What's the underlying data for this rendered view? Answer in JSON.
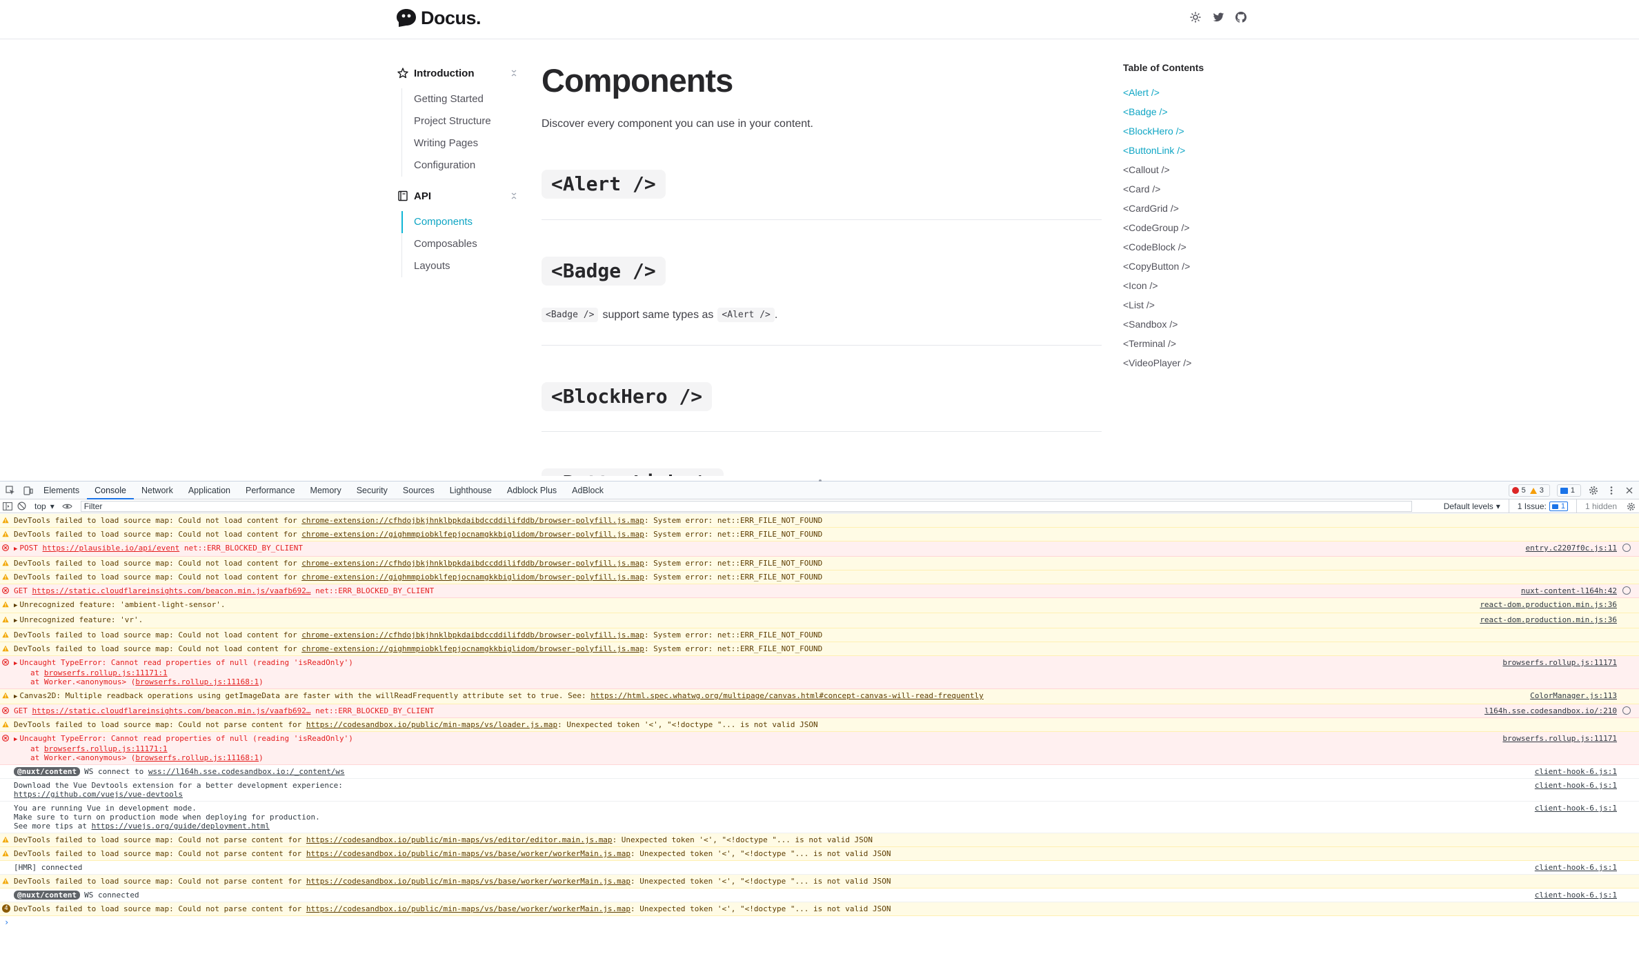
{
  "site": {
    "logo_text": "Docus.",
    "header_icons": [
      "sun-icon",
      "twitter-icon",
      "github-icon"
    ]
  },
  "nav": {
    "groups": [
      {
        "label": "Introduction",
        "icon": "star-icon",
        "items": [
          "Getting Started",
          "Project Structure",
          "Writing Pages",
          "Configuration"
        ]
      },
      {
        "label": "API",
        "icon": "book-icon",
        "items": [
          "Components",
          "Composables",
          "Layouts"
        ]
      }
    ],
    "active_item": "Components"
  },
  "main": {
    "title": "Components",
    "intro": "Discover every component you can use in your content.",
    "sections": [
      "<Alert />",
      "<Badge />",
      "<BlockHero />",
      "<ButtonLink />"
    ],
    "badge_text": {
      "code1": "<Badge />",
      "middle": "support same types as",
      "code2": "<Alert />",
      "end": "."
    }
  },
  "toc": {
    "title": "Table of Contents",
    "items": [
      "<Alert />",
      "<Badge />",
      "<BlockHero />",
      "<ButtonLink />",
      "<Callout />",
      "<Card />",
      "<CardGrid />",
      "<CodeGroup />",
      "<CodeBlock />",
      "<CopyButton />",
      "<Icon />",
      "<List />",
      "<Sandbox />",
      "<Terminal />",
      "<VideoPlayer />"
    ],
    "active_count": 4
  },
  "devtools": {
    "tabs": [
      "Elements",
      "Console",
      "Network",
      "Application",
      "Performance",
      "Memory",
      "Security",
      "Sources",
      "Lighthouse",
      "Adblock Plus",
      "AdBlock"
    ],
    "active_tab": "Console",
    "counts": {
      "errors": "5",
      "warnings": "3",
      "messages": "1"
    },
    "context": "top",
    "filter_placeholder": "Filter",
    "levels": "Default levels",
    "issues_label": "1 Issue:",
    "issues_count": "1",
    "hidden": "1 hidden",
    "colors": {
      "accent": "#10b6d6",
      "error": "#e41e1e",
      "warn_bg": "#fffbe5",
      "tab_underline": "#1a73e8"
    }
  },
  "console": [
    {
      "level": "warn",
      "text": "DevTools failed to load source map: Could not load content for ",
      "link": "chrome-extension://cfhdojbkjhnklbpkdaibdccddilifddb/browser-polyfill.js.map",
      "tail": ": System error: net::ERR_FILE_NOT_FOUND"
    },
    {
      "level": "warn",
      "text": "DevTools failed to load source map: Could not load content for ",
      "link": "chrome-extension://gighmmpiobklfepjocnamgkkbiglidom/browser-polyfill.js.map",
      "tail": ": System error: net::ERR_FILE_NOT_FOUND"
    },
    {
      "level": "error",
      "expand": true,
      "text": "POST ",
      "link": "https://plausible.io/api/event",
      "tail": " net::ERR_BLOCKED_BY_CLIENT",
      "source": "entry.c2207f0c.js:11",
      "src_icon": true
    },
    {
      "level": "warn",
      "text": "DevTools failed to load source map: Could not load content for ",
      "link": "chrome-extension://cfhdojbkjhnklbpkdaibdccddilifddb/browser-polyfill.js.map",
      "tail": ": System error: net::ERR_FILE_NOT_FOUND"
    },
    {
      "level": "warn",
      "text": "DevTools failed to load source map: Could not load content for ",
      "link": "chrome-extension://gighmmpiobklfepjocnamgkkbiglidom/browser-polyfill.js.map",
      "tail": ": System error: net::ERR_FILE_NOT_FOUND"
    },
    {
      "level": "error",
      "text": "GET ",
      "link": "https://static.cloudflareinsights.com/beacon.min.js/vaafb692…",
      "tail": " net::ERR_BLOCKED_BY_CLIENT",
      "source": "nuxt-content-l164h:42",
      "src_icon": true
    },
    {
      "level": "warn",
      "expand": true,
      "text": "Unrecognized feature: 'ambient-light-sensor'.",
      "source": "react-dom.production.min.js:36"
    },
    {
      "level": "warn",
      "expand": true,
      "text": "Unrecognized feature: 'vr'.",
      "source": "react-dom.production.min.js:36"
    },
    {
      "level": "warn",
      "text": "DevTools failed to load source map: Could not load content for ",
      "link": "chrome-extension://cfhdojbkjhnklbpkdaibdccddilifddb/browser-polyfill.js.map",
      "tail": ": System error: net::ERR_FILE_NOT_FOUND"
    },
    {
      "level": "warn",
      "text": "DevTools failed to load source map: Could not load content for ",
      "link": "chrome-extension://gighmmpiobklfepjocnamgkkbiglidom/browser-polyfill.js.map",
      "tail": ": System error: net::ERR_FILE_NOT_FOUND"
    },
    {
      "level": "error",
      "expand": true,
      "text": "Uncaught TypeError: Cannot read properties of null (reading 'isReadOnly')",
      "stack": [
        [
          "at ",
          "browserfs.rollup.js:11171:1",
          ""
        ],
        [
          "at Worker.<anonymous> (",
          "browserfs.rollup.js:11168:1",
          ")"
        ]
      ],
      "source": "browserfs.rollup.js:11171"
    },
    {
      "level": "warn",
      "expand": true,
      "text": "Canvas2D: Multiple readback operations using getImageData are faster with the willReadFrequently attribute set to true. See: ",
      "link": "https://html.spec.whatwg.org/multipage/canvas.html#concept-canvas-will-read-frequently",
      "tail": "",
      "source": "ColorManager.js:113"
    },
    {
      "level": "error",
      "text": "GET ",
      "link": "https://static.cloudflareinsights.com/beacon.min.js/vaafb692…",
      "tail": " net::ERR_BLOCKED_BY_CLIENT",
      "source": "l164h.sse.codesandbox.io/:210",
      "src_icon": true
    },
    {
      "level": "warn",
      "text": "DevTools failed to load source map: Could not parse content for ",
      "link": "https://codesandbox.io/public/min-maps/vs/loader.js.map",
      "tail": ": Unexpected token '<', \"<!doctype \"... is not valid JSON"
    },
    {
      "level": "error",
      "expand": true,
      "text": "Uncaught TypeError: Cannot read properties of null (reading 'isReadOnly')",
      "stack": [
        [
          "at ",
          "browserfs.rollup.js:11171:1",
          ""
        ],
        [
          "at Worker.<anonymous> (",
          "browserfs.rollup.js:11168:1",
          ")"
        ]
      ],
      "source": "browserfs.rollup.js:11171"
    },
    {
      "level": "info",
      "tag": "@nuxt/content",
      "text": "WS connect to ",
      "link": "wss://l164h.sse.codesandbox.io:/_content/ws",
      "tail": "",
      "source": "client-hook-6.js:1"
    },
    {
      "level": "info",
      "text": "Download the Vue Devtools extension for a better development experience:\n",
      "link": "https://github.com/vuejs/vue-devtools",
      "tail": "",
      "source": "client-hook-6.js:1"
    },
    {
      "level": "info",
      "text": "You are running Vue in development mode.\nMake sure to turn on production mode when deploying for production.\nSee more tips at ",
      "link": "https://vuejs.org/guide/deployment.html",
      "tail": "",
      "source": "client-hook-6.js:1"
    },
    {
      "level": "warn",
      "text": "DevTools failed to load source map: Could not parse content for ",
      "link": "https://codesandbox.io/public/min-maps/vs/editor/editor.main.js.map",
      "tail": ": Unexpected token '<', \"<!doctype \"... is not valid JSON"
    },
    {
      "level": "warn",
      "text": "DevTools failed to load source map: Could not parse content for ",
      "link": "https://codesandbox.io/public/min-maps/vs/base/worker/workerMain.js.map",
      "tail": ": Unexpected token '<', \"<!doctype \"... is not valid JSON"
    },
    {
      "level": "info",
      "text": "[HMR] connected",
      "source": "client-hook-6.js:1"
    },
    {
      "level": "warn",
      "text": "DevTools failed to load source map: Could not parse content for ",
      "link": "https://codesandbox.io/public/min-maps/vs/base/worker/workerMain.js.map",
      "tail": ": Unexpected token '<', \"<!doctype \"... is not valid JSON"
    },
    {
      "level": "info",
      "tag": "@nuxt/content",
      "text": "WS connected",
      "source": "client-hook-6.js:1"
    },
    {
      "level": "warn",
      "repeat": "4",
      "text": "DevTools failed to load source map: Could not parse content for ",
      "link": "https://codesandbox.io/public/min-maps/vs/base/worker/workerMain.js.map",
      "tail": ": Unexpected token '<', \"<!doctype \"... is not valid JSON"
    }
  ],
  "prompt_symbol": "›"
}
